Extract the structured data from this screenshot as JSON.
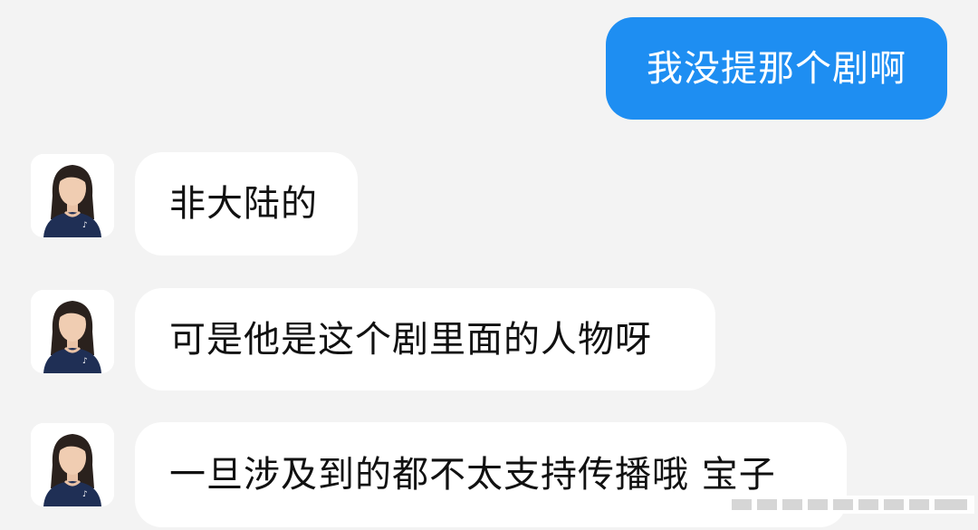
{
  "messages": [
    {
      "text": "我没提那个剧啊"
    },
    {
      "text": "非大陆的"
    },
    {
      "text": "可是他是这个剧里面的人物呀"
    },
    {
      "text": "一旦涉及到的都不太支持传播哦 宝子"
    }
  ],
  "colors": {
    "background": "#f3f3f3",
    "outgoing_bubble": "#1e8ef2",
    "incoming_bubble": "#ffffff",
    "avatar_shirt": "#1f2f55"
  }
}
